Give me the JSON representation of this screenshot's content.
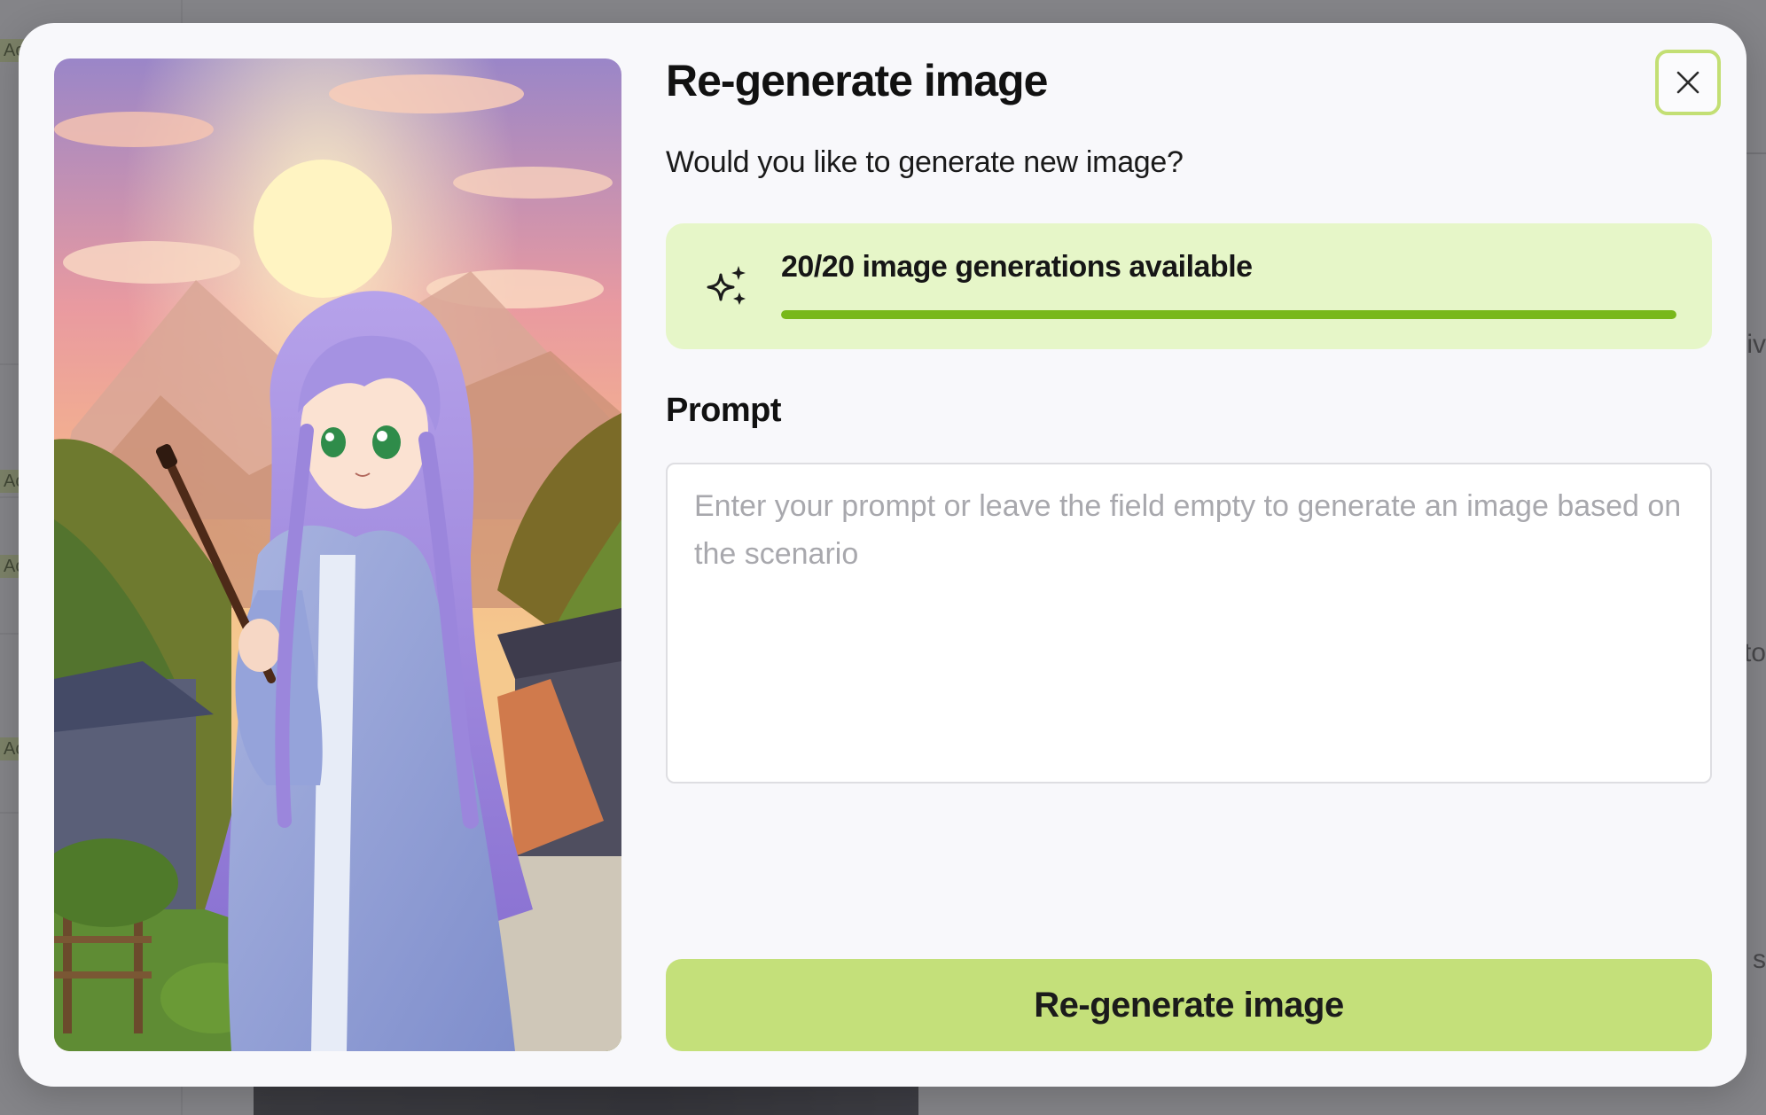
{
  "background": {
    "sidebar_tags": [
      "Ac",
      "Ac",
      "Ac",
      "Ac"
    ],
    "right_fragments": [
      "iv",
      "to",
      "s"
    ]
  },
  "modal": {
    "title": "Re-generate image",
    "subtitle": "Would you like to generate new image?",
    "close_icon": "close-icon",
    "quota": {
      "icon": "sparkles-icon",
      "text": "20/20 image generations available",
      "used": 20,
      "total": 20,
      "fraction": 1.0
    },
    "prompt": {
      "label": "Prompt",
      "value": "",
      "placeholder": "Enter your prompt or leave the field empty to generate an image based on the scenario"
    },
    "submit_label": "Re-generate image"
  },
  "colors": {
    "accent": "#c4e07a",
    "accent_border": "#c3df74",
    "quota_bg": "#e6f6c8",
    "progress": "#78b81a",
    "modal_bg": "#f8f8fb"
  }
}
